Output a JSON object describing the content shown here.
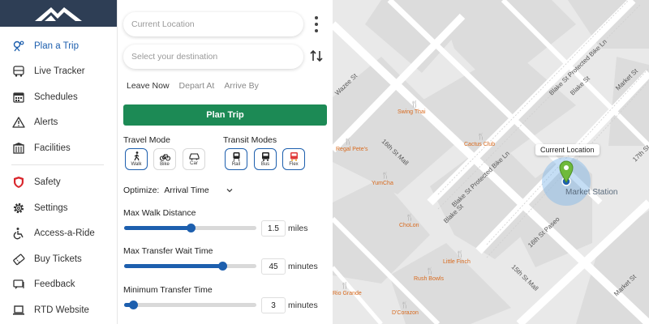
{
  "sidebar": {
    "items": [
      {
        "label": "Plan a Trip",
        "icon": "map-pin-route-icon"
      },
      {
        "label": "Live Tracker",
        "icon": "bus-icon"
      },
      {
        "label": "Schedules",
        "icon": "calendar-icon"
      },
      {
        "label": "Alerts",
        "icon": "warning-icon"
      },
      {
        "label": "Facilities",
        "icon": "building-icon"
      },
      {
        "label": "Safety",
        "icon": "shield-icon"
      },
      {
        "label": "Settings",
        "icon": "gear-icon"
      },
      {
        "label": "Access-a-Ride",
        "icon": "accessibility-icon"
      },
      {
        "label": "Buy Tickets",
        "icon": "ticket-icon"
      },
      {
        "label": "Feedback",
        "icon": "chat-icon"
      },
      {
        "label": "RTD Website",
        "icon": "laptop-icon"
      }
    ],
    "active_color": "#1d5fae",
    "logo_bg": "#2e3e55"
  },
  "planner": {
    "from_placeholder": "Current Location",
    "to_placeholder": "Select your destination",
    "time_tabs": [
      "Leave Now",
      "Depart At",
      "Arrive By"
    ],
    "plan_button": "Plan Trip",
    "plan_button_color": "#1c8a55",
    "travel_mode_label": "Travel Mode",
    "travel_modes": [
      "Walk",
      "Bike",
      "Car"
    ],
    "transit_modes_label": "Transit Modes",
    "transit_modes": [
      "Rail",
      "Bus",
      "Flex"
    ],
    "optimize_label": "Optimize:",
    "optimize_value": "Arrival Time",
    "sliders": [
      {
        "label": "Max Walk Distance",
        "value": "1.5",
        "unit": "miles",
        "fraction": 0.5
      },
      {
        "label": "Max Transfer Wait Time",
        "value": "45",
        "unit": "minutes",
        "fraction": 0.74
      },
      {
        "label": "Minimum Transfer Time",
        "value": "3",
        "unit": "minutes",
        "fraction": 0.07
      }
    ]
  },
  "map": {
    "current_location_label": "Current Location",
    "station_label": "Market Station",
    "streets": [
      "Wazee St",
      "Blake St",
      "Blake St Protected Bike Ln",
      "Market St",
      "16th St Mall",
      "15th St Mall",
      "16th St Paseo",
      "17th St"
    ],
    "places": [
      "Swing Thai",
      "Cactus Club",
      "Regal Pete's",
      "YumCha",
      "ChoLon",
      "Little Finch",
      "Rush Bowls",
      "Rio Grande",
      "D'Corazon"
    ]
  }
}
